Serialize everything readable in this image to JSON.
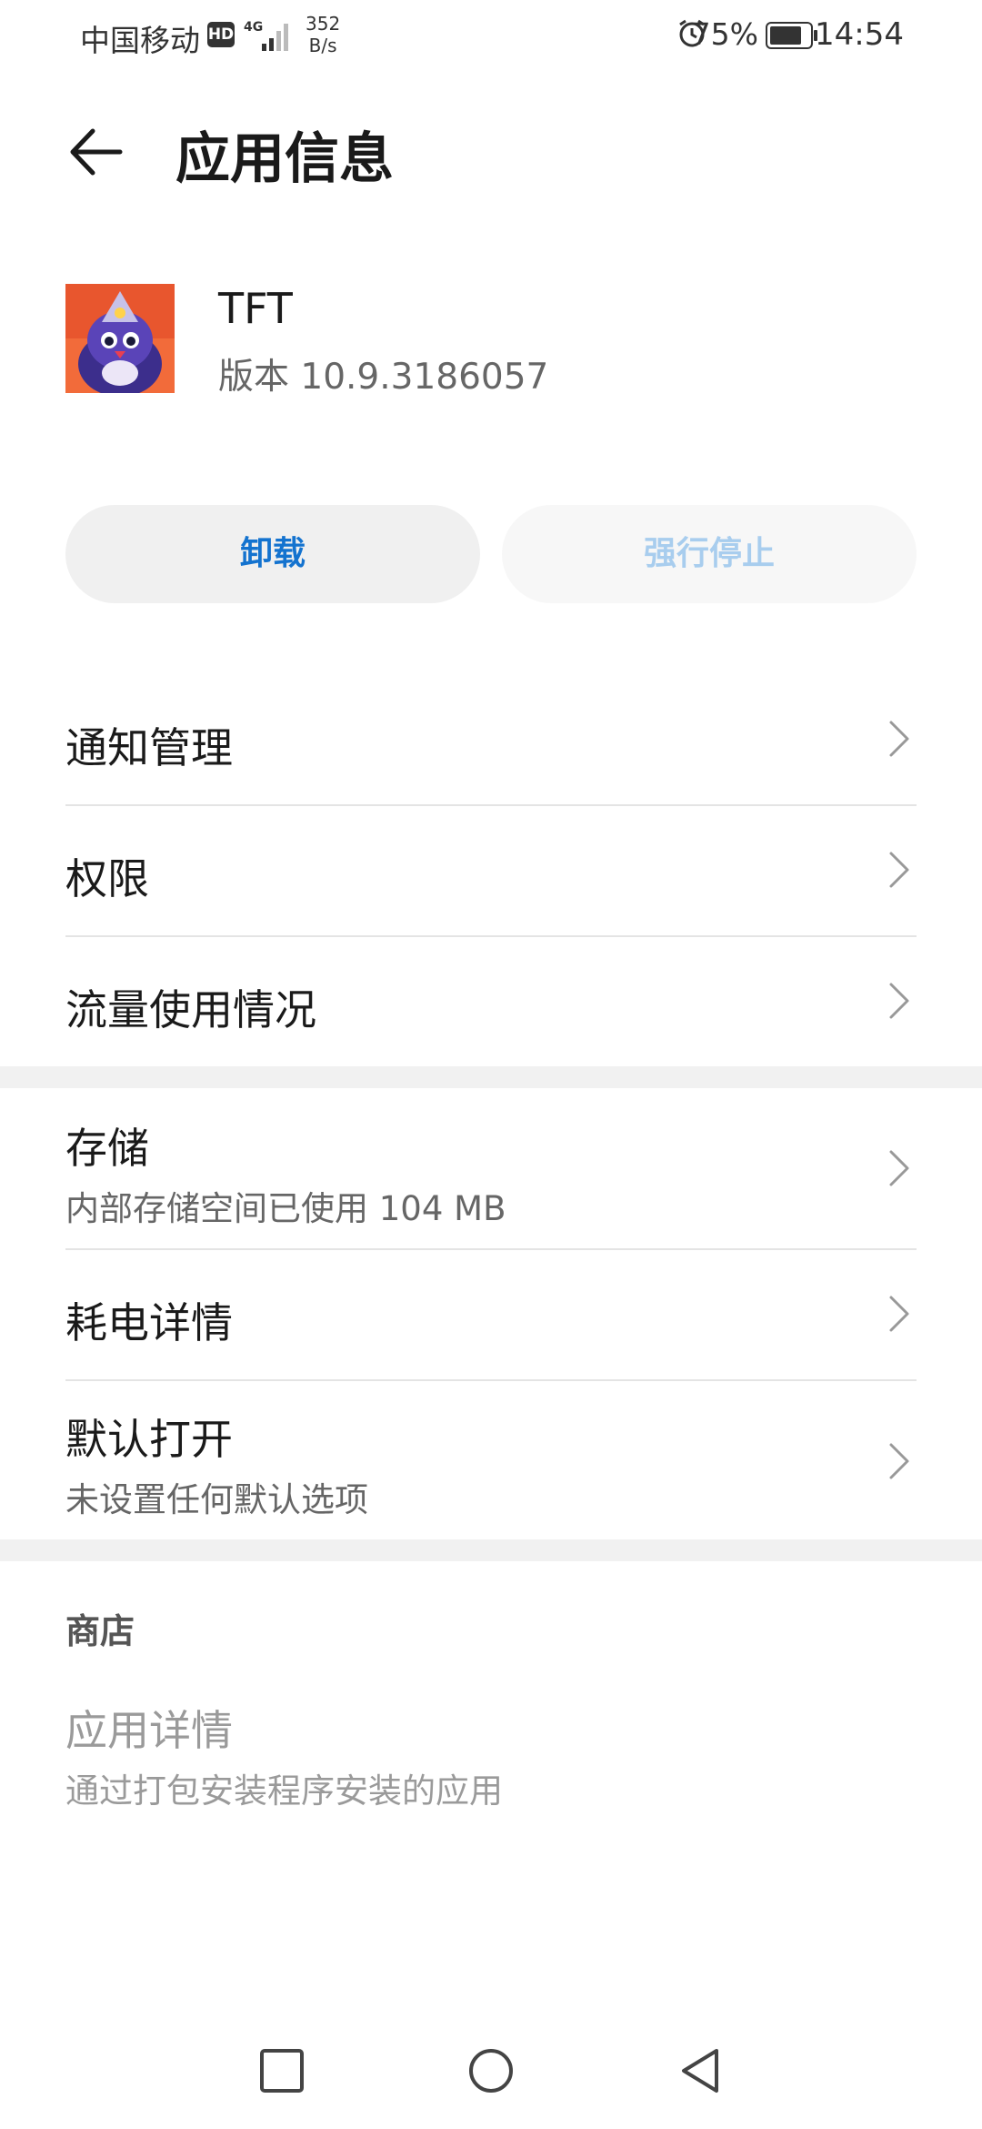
{
  "status_bar": {
    "carrier": "中国移动",
    "hd_badge": "HD",
    "network_type": "4G",
    "speed_value": "352",
    "speed_unit": "B/s",
    "battery_percent": "75%",
    "time": "14:54"
  },
  "header": {
    "title": "应用信息"
  },
  "app": {
    "name": "TFT",
    "version": "版本 10.9.3186057"
  },
  "actions": {
    "uninstall_label": "卸载",
    "force_stop_label": "强行停止",
    "uninstall_color": "#1473cf",
    "force_stop_color": "#a8cdee"
  },
  "settings": {
    "notifications": "通知管理",
    "permissions": "权限",
    "data_usage": "流量使用情况",
    "storage_title": "存储",
    "storage_sub": "内部存储空间已使用 104 MB",
    "battery_title": "耗电详情",
    "default_open_title": "默认打开",
    "default_open_sub": "未设置任何默认选项"
  },
  "store": {
    "header": "商店",
    "title": "应用详情",
    "subtitle": "通过打包安装程序安装的应用"
  }
}
